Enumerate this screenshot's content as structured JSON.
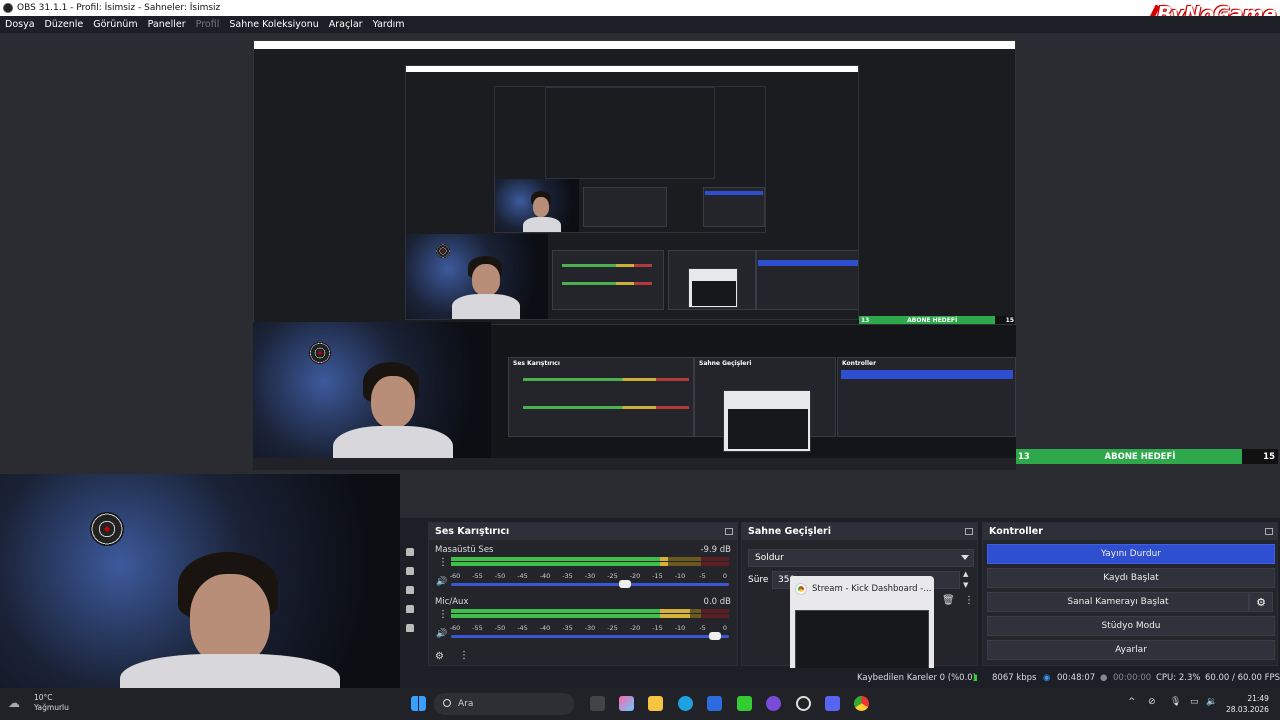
{
  "window": {
    "title": "OBS 31.1.1 - Profil: İsimsiz - Sahneler: İsimsiz",
    "brand": "ByNoGame"
  },
  "menu": [
    "Dosya",
    "Düzenle",
    "Görünüm",
    "Paneller",
    "Profil",
    "Sahne Koleksiyonu",
    "Araçlar",
    "Yardım"
  ],
  "goal": {
    "label": "ABONE HEDEFİ",
    "current": "13",
    "target": "15"
  },
  "mixer": {
    "title": "Ses Karıştırıcı",
    "channels": [
      {
        "name": "Masaüstü Ses",
        "db": "-9.9 dB",
        "level": 0.78,
        "volume": 0.63
      },
      {
        "name": "Mic/Aux",
        "db": "0.0 dB",
        "level": 0.86,
        "volume": 0.97
      }
    ],
    "ticks": [
      "-60",
      "-55",
      "-50",
      "-45",
      "-40",
      "-35",
      "-30",
      "-25",
      "-20",
      "-15",
      "-10",
      "-5",
      "0"
    ]
  },
  "transitions": {
    "title": "Sahne Geçişleri",
    "selected": "Soldur",
    "duration_label": "Süre",
    "duration_value": "350"
  },
  "controls": {
    "title": "Kontroller",
    "stop_stream": "Yayını Durdur",
    "start_recording": "Kaydı Başlat",
    "start_virtualcam": "Sanal Kamerayı Başlat",
    "studio_mode": "Stüdyo Modu",
    "settings": "Ayarlar"
  },
  "thumbnail": {
    "title": "Stream - Kick Dashboard -..."
  },
  "status": {
    "dropped": "Kaybedilen Kareler 0 (%0.0)",
    "bitrate": "8067 kbps",
    "stream_time": "00:48:07",
    "rec_time": "00:00:00",
    "cpu": "CPU: 2.3%",
    "fps": "60.00 / 60.00 FPS"
  },
  "taskbar": {
    "temp": "10°C",
    "weather": "Yağmurlu",
    "search_placeholder": "Ara",
    "time": "21:49",
    "date": "28.03.2026"
  },
  "colors": {
    "accent": "#2f4fd1",
    "goal_green": "#2ea84a",
    "panel": "#23252b"
  }
}
